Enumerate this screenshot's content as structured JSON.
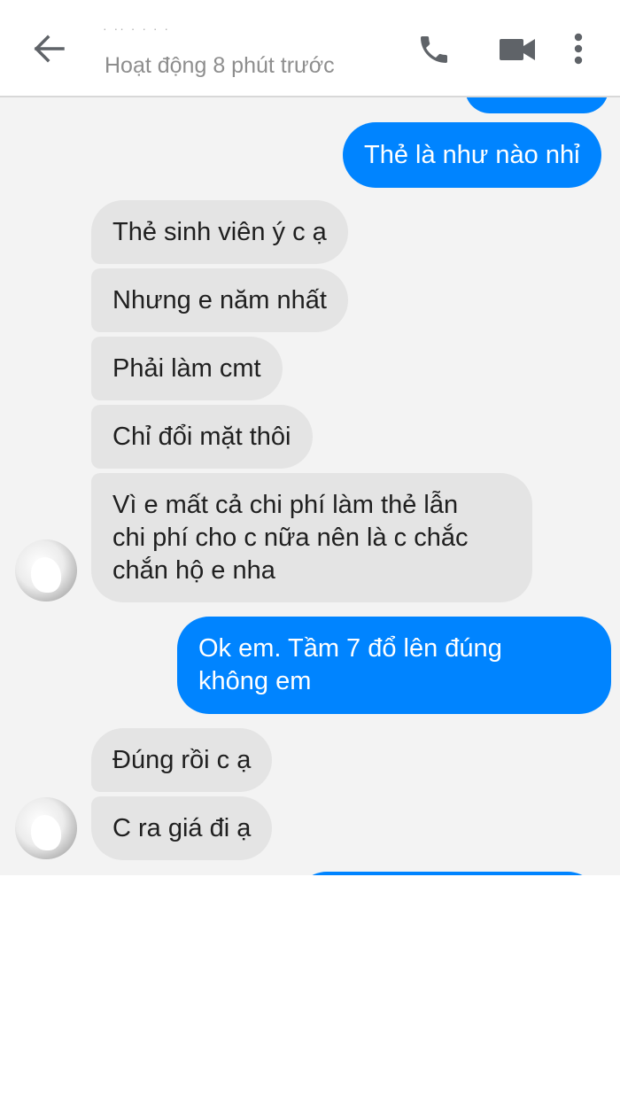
{
  "header": {
    "contact_name": "·  ··  ·  ·    · ·",
    "status": "Hoạt động 8 phút trước",
    "back_icon": "arrow-left-icon",
    "call_icon": "phone-icon",
    "video_icon": "video-camera-icon",
    "more_icon": "more-vertical-icon"
  },
  "colors": {
    "outgoing_bubble": "#0084ff",
    "incoming_bubble": "#e4e4e4",
    "chat_background": "#f3f3f3"
  },
  "messages": [
    {
      "from": "me",
      "text": "Thẻ là như nào nhỉ"
    },
    {
      "from": "contact",
      "text": "Thẻ sinh viên ý c ạ"
    },
    {
      "from": "contact",
      "text": "Nhưng e năm nhất"
    },
    {
      "from": "contact",
      "text": "Phải làm cmt"
    },
    {
      "from": "contact",
      "text": "Chỉ đổi mặt thôi"
    },
    {
      "from": "contact",
      "text": "Vì e mất cả chi phí làm thẻ lẫn\nchi phí cho c nữa nên là c chắc\nchắn hộ e nha"
    },
    {
      "from": "me",
      "text": "Ok em. Tầm 7 đổ lên đúng\nkhông em"
    },
    {
      "from": "contact",
      "text": "Đúng rồi c ạ"
    },
    {
      "from": "contact",
      "text": "C ra giá đi ạ"
    }
  ]
}
